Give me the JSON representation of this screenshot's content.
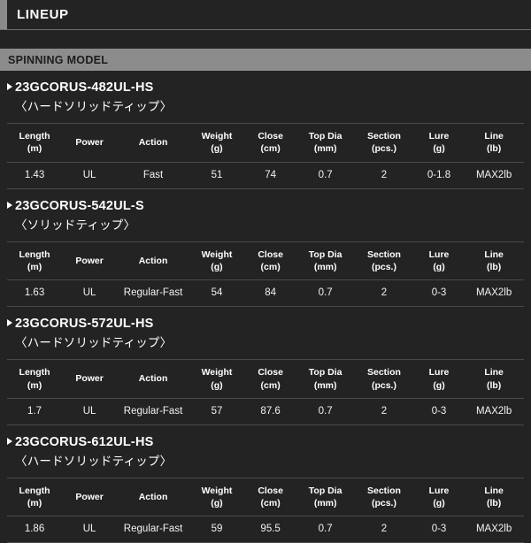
{
  "page": {
    "title": "LINEUP",
    "section_title": "SPINNING MODEL",
    "accent_color": "#8c8c8c",
    "background_color": "#232323"
  },
  "columns": [
    {
      "label": "Length",
      "unit": "(m)"
    },
    {
      "label": "Power",
      "unit": ""
    },
    {
      "label": "Action",
      "unit": ""
    },
    {
      "label": "Weight",
      "unit": "(g)"
    },
    {
      "label": "Close",
      "unit": "(cm)"
    },
    {
      "label": "Top Dia",
      "unit": "(mm)"
    },
    {
      "label": "Section",
      "unit": "(pcs.)"
    },
    {
      "label": "Lure",
      "unit": "(g)"
    },
    {
      "label": "Line",
      "unit": "(lb)"
    }
  ],
  "models": [
    {
      "name": "23GCORUS-482UL-HS",
      "subtitle": "〈ハードソリッドティップ〉",
      "specs": {
        "length": "1.43",
        "power": "UL",
        "action": "Fast",
        "weight": "51",
        "close": "74",
        "top_dia": "0.7",
        "section": "2",
        "lure": "0-1.8",
        "line": "MAX2lb"
      }
    },
    {
      "name": "23GCORUS-542UL-S",
      "subtitle": "〈ソリッドティップ〉",
      "specs": {
        "length": "1.63",
        "power": "UL",
        "action": "Regular-Fast",
        "weight": "54",
        "close": "84",
        "top_dia": "0.7",
        "section": "2",
        "lure": "0-3",
        "line": "MAX2lb"
      }
    },
    {
      "name": "23GCORUS-572UL-HS",
      "subtitle": "〈ハードソリッドティップ〉",
      "specs": {
        "length": "1.7",
        "power": "UL",
        "action": "Regular-Fast",
        "weight": "57",
        "close": "87.6",
        "top_dia": "0.7",
        "section": "2",
        "lure": "0-3",
        "line": "MAX2lb"
      }
    },
    {
      "name": "23GCORUS-612UL-HS",
      "subtitle": "〈ハードソリッドティップ〉",
      "specs": {
        "length": "1.86",
        "power": "UL",
        "action": "Regular-Fast",
        "weight": "59",
        "close": "95.5",
        "top_dia": "0.7",
        "section": "2",
        "lure": "0-3",
        "line": "MAX2lb"
      }
    }
  ]
}
